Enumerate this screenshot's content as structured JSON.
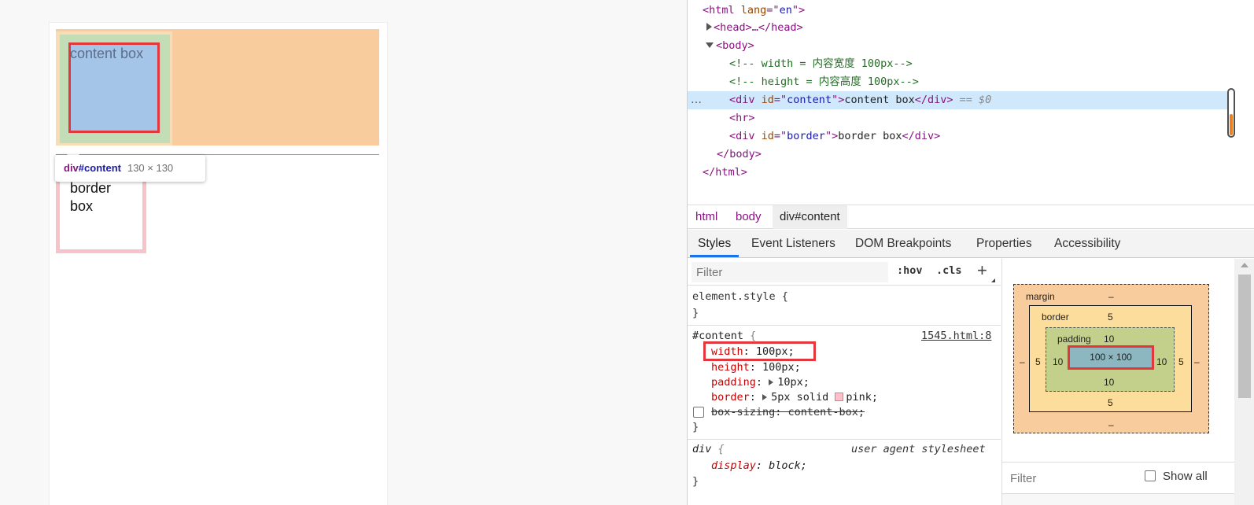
{
  "page": {
    "content_box_text": "content box",
    "border_box_text": "border box"
  },
  "tooltip": {
    "tag": "div",
    "id": "#content",
    "size": "130 × 130"
  },
  "dom": {
    "html_open": [
      "<html ",
      "lang",
      "=\"",
      "en",
      "\">"
    ],
    "head": "<head>…</head>",
    "body_open": "<body>",
    "comment_width": "<!-- width = 内容宽度 100px-->",
    "comment_height": "<!-- height = 内容高度 100px-->",
    "selected": {
      "open": "<div ",
      "attr": "id",
      "eq": "=\"",
      "val": "content",
      "close": "\">",
      "text": "content box",
      "end": "</div>",
      "marker": "== $0"
    },
    "ellipsis": "…",
    "hr": "<hr>",
    "border_div": {
      "open": "<div ",
      "attr": "id",
      "eq": "=\"",
      "val": "border",
      "close": "\">",
      "text": "border box",
      "end": "</div>"
    },
    "body_close": "</body>",
    "html_close": "</html>"
  },
  "breadcrumbs": [
    "html",
    "body",
    "div#content"
  ],
  "tabs": [
    "Styles",
    "Event Listeners",
    "DOM Breakpoints",
    "Properties",
    "Accessibility"
  ],
  "styles": {
    "filter_placeholder": "Filter",
    "hov": ":hov",
    "cls": ".cls",
    "plus": "+",
    "element_style": "element.style {",
    "close_brace": "}",
    "content_rule": {
      "selector": "#content",
      "open": " {",
      "source": "1545.html:8",
      "width_prop": "width",
      "width_val": ": 100px;",
      "height_prop": "height",
      "height_val": ": 100px;",
      "padding_prop": "padding",
      "padding_sep": ":",
      "padding_val": "10px;",
      "border_prop": "border",
      "border_sep": ":",
      "border_val1": "5px solid",
      "border_val2": "pink;",
      "boxsizing": "box-sizing: content-box;"
    },
    "div_rule": {
      "selector": "div",
      "open": " {",
      "source": "user agent stylesheet",
      "prop": "display",
      "val": ": block;"
    }
  },
  "box_model": {
    "margin_label": "margin",
    "margin_top": "–",
    "margin_bottom": "–",
    "margin_left": "–",
    "margin_right": "–",
    "border_label": "border",
    "border_top": "5",
    "border_bottom": "5",
    "border_left": "5",
    "border_right": "5",
    "padding_label": "padding",
    "padding_top": "10",
    "padding_bottom": "10",
    "padding_left": "10",
    "padding_right": "10",
    "content": "100 × 100",
    "filter_placeholder": "Filter",
    "show_all": "Show all"
  },
  "colors": {
    "margin": "#f9cc9d",
    "border": "#fddd9b",
    "padding": "#c3d08b",
    "content": "#8cb6c0",
    "highlight": "#e2373c",
    "swatch_pink": "#ffc0cb"
  }
}
